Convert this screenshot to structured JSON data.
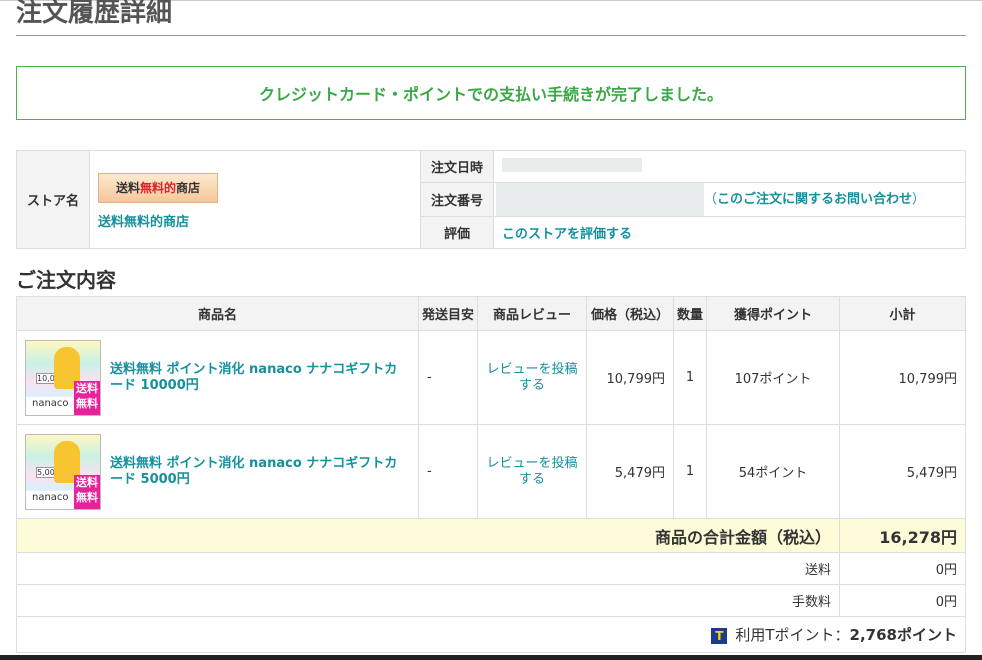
{
  "page": {
    "title": "注文履歴詳細"
  },
  "notice": "クレジットカード・ポイントでの支払い手続きが完了しました。",
  "order_info": {
    "store_label": "ストア名",
    "store_logo_text_a": "送料",
    "store_logo_text_b": "無料的",
    "store_logo_text_c": "商店",
    "store_name": "送料無料的商店",
    "date_label": "注文日時",
    "order_no_label": "注文番号",
    "inquiry_open": "（",
    "inquiry_link": "このご注文に関するお問い合わせ",
    "inquiry_close": "）",
    "rating_label": "評価",
    "rating_link": "このストアを評価する"
  },
  "section_title": "ご注文内容",
  "table": {
    "headers": [
      "商品名",
      "発送目安",
      "商品レビュー",
      "価格（税込）",
      "数量",
      "獲得ポイント",
      "小計"
    ],
    "rows": [
      {
        "name": "送料無料 ポイント消化 nanaco ナナコギフトカード 10000円",
        "ship": "-",
        "review": "レビューを投稿する",
        "price": "10,799円",
        "qty": "1",
        "points": "107ポイント",
        "subtotal": "10,799円",
        "thumb_value": "10,000",
        "thumb_brand": "nanaco",
        "thumb_badge": "送料無料"
      },
      {
        "name": "送料無料 ポイント消化 nanaco ナナコギフトカード 5000円",
        "ship": "-",
        "review": "レビューを投稿する",
        "price": "5,479円",
        "qty": "1",
        "points": "54ポイント",
        "subtotal": "5,479円",
        "thumb_value": "5,000",
        "thumb_brand": "nanaco",
        "thumb_badge": "送料無料"
      }
    ],
    "total_label": "商品の合計金額（税込）",
    "total_value": "16,278円",
    "shipping_label": "送料",
    "shipping_value": "0円",
    "fee_label": "手数料",
    "fee_value": "0円",
    "tpoint_icon": "T",
    "tpoint_label": "利用Tポイント：",
    "tpoint_value": "2,768ポイント"
  }
}
